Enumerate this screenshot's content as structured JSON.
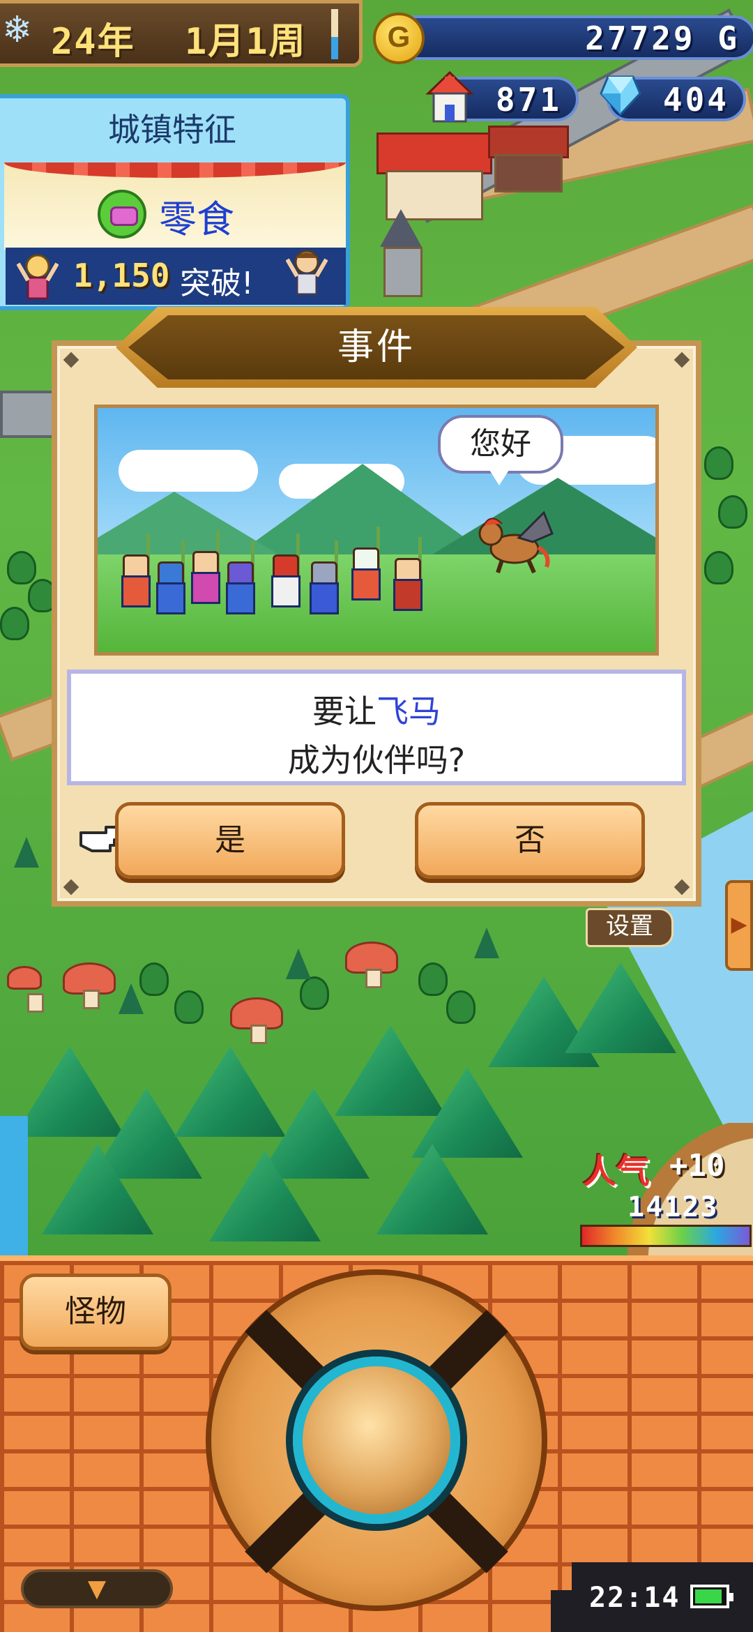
{
  "hud": {
    "year": "24年",
    "month_week": "1月1周",
    "gold": "27729",
    "gold_unit": "G",
    "gold_coin_letter": "G",
    "population": "871",
    "crystals": "404"
  },
  "town_feature": {
    "title": "城镇特征",
    "feature_name": "零食",
    "feature_icon": "candy-icon",
    "break_number": "1,150",
    "break_label": "突破!"
  },
  "event": {
    "title": "事件",
    "speech_bubble": "您好",
    "question_prefix": "要让",
    "creature_name": "飞马",
    "question_line2": "成为伙伴吗?",
    "yes_label": "是",
    "no_label": "否"
  },
  "side": {
    "settings_label": "设置"
  },
  "popularity": {
    "label": "人气",
    "delta": "+10",
    "value": "14123"
  },
  "bottom": {
    "monster_label": "怪物",
    "clock": "22:14"
  },
  "colors": {
    "accent_blue": "#2f43d8",
    "button_orange": "#f1a85a",
    "panel_cream": "#f4dfb2",
    "header_brown": "#7a5218"
  }
}
